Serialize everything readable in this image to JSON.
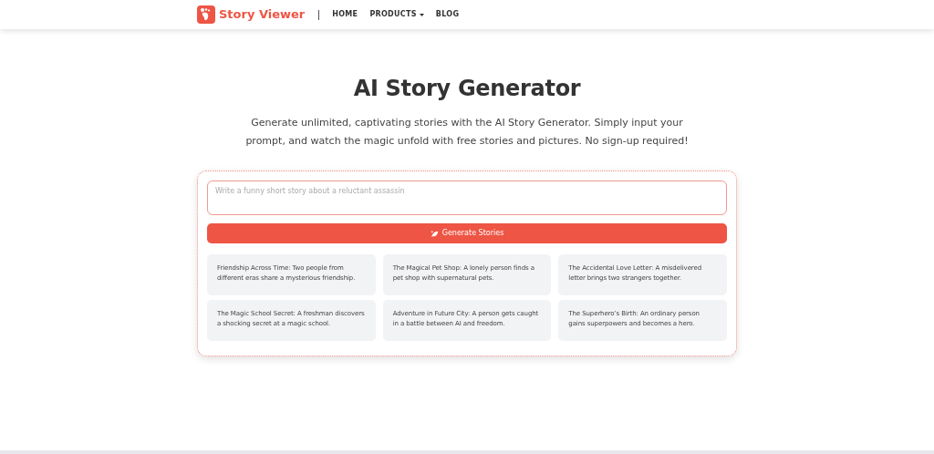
{
  "header": {
    "brand": "Story Viewer",
    "nav": [
      {
        "label": "HOME",
        "dropdown": false
      },
      {
        "label": "PRODUCTS",
        "dropdown": true
      },
      {
        "label": "BLOG",
        "dropdown": false
      }
    ]
  },
  "hero": {
    "title": "AI Story Generator",
    "description": "Generate unlimited, captivating stories with the AI Story Generator. Simply input your prompt, and watch the magic unfold with free stories and pictures. No sign-up required!"
  },
  "generator": {
    "prompt": {
      "placeholder": "Write a funny short story about a reluctant assassin"
    },
    "button": "Generate Stories",
    "suggestions": [
      "Friendship Across Time: Two people from different eras share a mysterious friendship.",
      "The Magical Pet Shop: A lonely person finds a pet shop with supernatural pets.",
      "The Accidental Love Letter: A misdelivered letter brings two strangers together.",
      "The Magic School Secret: A freshman discovers a shocking secret at a magic school.",
      "Adventure in Future City: A person gets caught in a battle between AI and freedom.",
      "The Superhero’s Birth: An ordinary person gains superpowers and becomes a hero."
    ]
  }
}
